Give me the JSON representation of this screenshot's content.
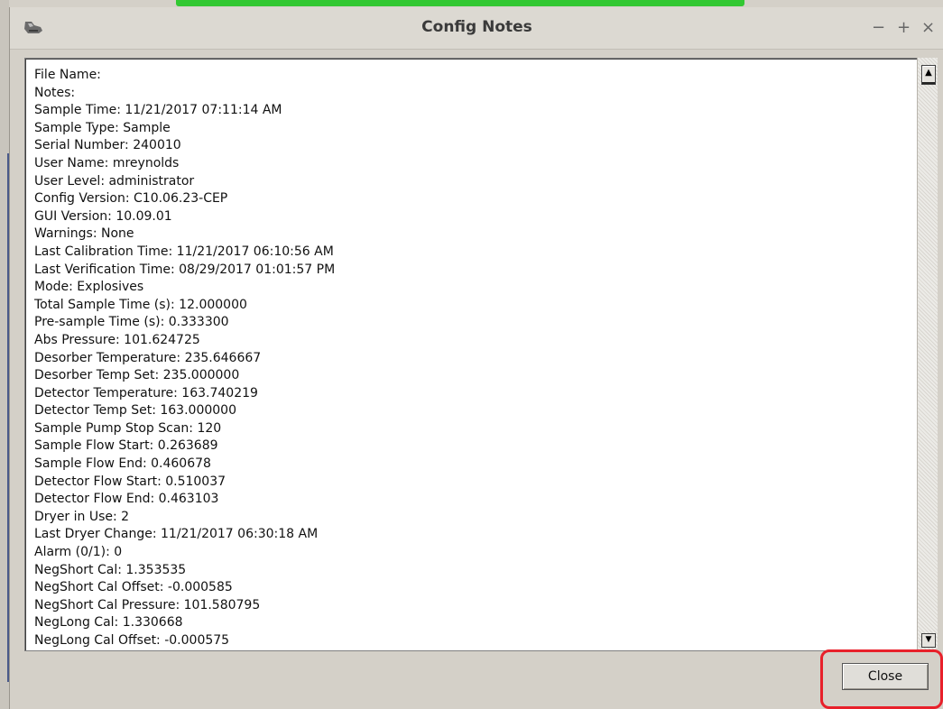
{
  "window": {
    "title": "Config Notes",
    "controls": {
      "minimize": "−",
      "maximize": "+",
      "close": "×"
    }
  },
  "notes": {
    "lines": [
      "File Name:",
      "Notes:",
      "Sample Time: 11/21/2017 07:11:14 AM",
      "Sample Type: Sample",
      "Serial Number: 240010",
      "User Name: mreynolds",
      "User Level: administrator",
      "Config Version: C10.06.23-CEP",
      "GUI Version: 10.09.01",
      "Warnings: None",
      "Last Calibration Time: 11/21/2017 06:10:56 AM",
      "Last Verification Time: 08/29/2017 01:01:57 PM",
      "Mode: Explosives",
      "Total Sample Time (s): 12.000000",
      "Pre-sample Time (s): 0.333300",
      "Abs Pressure: 101.624725",
      "Desorber Temperature: 235.646667",
      "Desorber Temp Set: 235.000000",
      "Detector Temperature: 163.740219",
      "Detector Temp Set: 163.000000",
      "Sample Pump Stop Scan: 120",
      "Sample Flow Start: 0.263689",
      "Sample Flow End: 0.460678",
      "Detector Flow Start: 0.510037",
      "Detector Flow End: 0.463103",
      "Dryer in Use: 2",
      "Last Dryer Change: 11/21/2017 06:30:18 AM",
      "Alarm (0/1): 0",
      "NegShort Cal: 1.353535",
      "NegShort Cal Offset: -0.000585",
      "NegShort Cal Pressure: 101.580795",
      "NegLong Cal: 1.330668",
      "NegLong Cal Offset: -0.000575"
    ]
  },
  "scrollbar": {
    "up_glyph": "▲",
    "down_glyph": "▼"
  },
  "buttons": {
    "close_label": "Close"
  },
  "colors": {
    "highlight": "#e8202a",
    "desktop_accent": "#32c832"
  },
  "icons": {
    "app": "printer-icon"
  }
}
